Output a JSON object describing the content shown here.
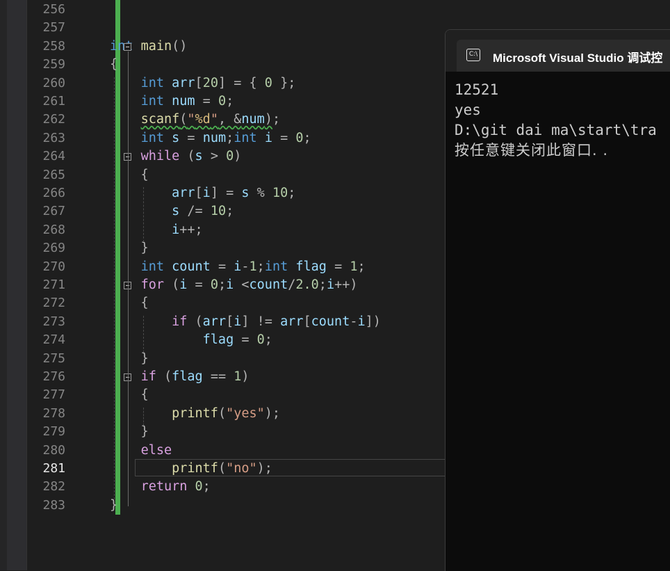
{
  "editor": {
    "lines": [
      {
        "n": "256"
      },
      {
        "n": "257"
      },
      {
        "n": "258"
      },
      {
        "n": "259"
      },
      {
        "n": "260"
      },
      {
        "n": "261"
      },
      {
        "n": "262"
      },
      {
        "n": "263"
      },
      {
        "n": "264"
      },
      {
        "n": "265"
      },
      {
        "n": "266"
      },
      {
        "n": "267"
      },
      {
        "n": "268"
      },
      {
        "n": "269"
      },
      {
        "n": "270"
      },
      {
        "n": "271"
      },
      {
        "n": "272"
      },
      {
        "n": "273"
      },
      {
        "n": "274"
      },
      {
        "n": "275"
      },
      {
        "n": "276"
      },
      {
        "n": "277"
      },
      {
        "n": "278"
      },
      {
        "n": "279"
      },
      {
        "n": "280"
      },
      {
        "n": "281"
      },
      {
        "n": "282"
      },
      {
        "n": "283"
      }
    ],
    "active_line": "281",
    "code": {
      "l258": [
        [
          "kw",
          "int"
        ],
        [
          "pun",
          " "
        ],
        [
          "fn",
          "main"
        ],
        [
          "pun",
          "()"
        ]
      ],
      "l259": [
        [
          "pun",
          "{"
        ]
      ],
      "l260": [
        [
          "pun",
          "    "
        ],
        [
          "kw",
          "int"
        ],
        [
          "pun",
          " "
        ],
        [
          "var",
          "arr"
        ],
        [
          "pun",
          "["
        ],
        [
          "num",
          "20"
        ],
        [
          "pun",
          "] = { "
        ],
        [
          "num",
          "0"
        ],
        [
          "pun",
          " };"
        ]
      ],
      "l261": [
        [
          "pun",
          "    "
        ],
        [
          "kw",
          "int"
        ],
        [
          "pun",
          " "
        ],
        [
          "var",
          "num"
        ],
        [
          "pun",
          " = "
        ],
        [
          "num",
          "0"
        ],
        [
          "pun",
          ";"
        ]
      ],
      "l262": [
        [
          "pun",
          "    "
        ],
        [
          "fn squig",
          "scanf"
        ],
        [
          "pun squig",
          "("
        ],
        [
          "str squig",
          "\""
        ],
        [
          "fmt squig",
          "%d"
        ],
        [
          "str squig",
          "\""
        ],
        [
          "pun squig",
          ", &"
        ],
        [
          "var squig",
          "num"
        ],
        [
          "pun squig",
          ")"
        ],
        [
          "pun",
          ";"
        ]
      ],
      "l263": [
        [
          "pun",
          "    "
        ],
        [
          "kw",
          "int"
        ],
        [
          "pun",
          " "
        ],
        [
          "var",
          "s"
        ],
        [
          "pun",
          " = "
        ],
        [
          "var",
          "num"
        ],
        [
          "pun",
          ";"
        ],
        [
          "kw",
          "int"
        ],
        [
          "pun",
          " "
        ],
        [
          "var",
          "i"
        ],
        [
          "pun",
          " = "
        ],
        [
          "num",
          "0"
        ],
        [
          "pun",
          ";"
        ]
      ],
      "l264": [
        [
          "pun",
          "    "
        ],
        [
          "ctl",
          "while"
        ],
        [
          "pun",
          " ("
        ],
        [
          "var",
          "s"
        ],
        [
          "pun",
          " > "
        ],
        [
          "num",
          "0"
        ],
        [
          "pun",
          ")"
        ]
      ],
      "l265": [
        [
          "pun",
          "    {"
        ]
      ],
      "l266": [
        [
          "pun",
          "        "
        ],
        [
          "var",
          "arr"
        ],
        [
          "pun",
          "["
        ],
        [
          "var",
          "i"
        ],
        [
          "pun",
          "] = "
        ],
        [
          "var",
          "s"
        ],
        [
          "pun",
          " % "
        ],
        [
          "num",
          "10"
        ],
        [
          "pun",
          ";"
        ]
      ],
      "l267": [
        [
          "pun",
          "        "
        ],
        [
          "var",
          "s"
        ],
        [
          "pun",
          " /= "
        ],
        [
          "num",
          "10"
        ],
        [
          "pun",
          ";"
        ]
      ],
      "l268": [
        [
          "pun",
          "        "
        ],
        [
          "var",
          "i"
        ],
        [
          "pun",
          "++;"
        ]
      ],
      "l269": [
        [
          "pun",
          "    }"
        ]
      ],
      "l270": [
        [
          "pun",
          "    "
        ],
        [
          "kw",
          "int"
        ],
        [
          "pun",
          " "
        ],
        [
          "var",
          "count"
        ],
        [
          "pun",
          " = "
        ],
        [
          "var",
          "i"
        ],
        [
          "pun",
          "-"
        ],
        [
          "num",
          "1"
        ],
        [
          "pun",
          ";"
        ],
        [
          "kw",
          "int"
        ],
        [
          "pun",
          " "
        ],
        [
          "var",
          "flag"
        ],
        [
          "pun",
          " = "
        ],
        [
          "num",
          "1"
        ],
        [
          "pun",
          ";"
        ]
      ],
      "l271": [
        [
          "pun",
          "    "
        ],
        [
          "ctl",
          "for"
        ],
        [
          "pun",
          " ("
        ],
        [
          "var",
          "i"
        ],
        [
          "pun",
          " = "
        ],
        [
          "num",
          "0"
        ],
        [
          "pun",
          ";"
        ],
        [
          "var",
          "i"
        ],
        [
          "pun",
          " <"
        ],
        [
          "var",
          "count"
        ],
        [
          "pun",
          "/"
        ],
        [
          "num",
          "2.0"
        ],
        [
          "pun",
          ";"
        ],
        [
          "var",
          "i"
        ],
        [
          "pun",
          "++)"
        ]
      ],
      "l272": [
        [
          "pun",
          "    {"
        ]
      ],
      "l273": [
        [
          "pun",
          "        "
        ],
        [
          "ctl",
          "if"
        ],
        [
          "pun",
          " ("
        ],
        [
          "var",
          "arr"
        ],
        [
          "pun",
          "["
        ],
        [
          "var",
          "i"
        ],
        [
          "pun",
          "] != "
        ],
        [
          "var",
          "arr"
        ],
        [
          "pun",
          "["
        ],
        [
          "var",
          "count"
        ],
        [
          "pun",
          "-"
        ],
        [
          "var",
          "i"
        ],
        [
          "pun",
          "])"
        ]
      ],
      "l274": [
        [
          "pun",
          "            "
        ],
        [
          "var",
          "flag"
        ],
        [
          "pun",
          " = "
        ],
        [
          "num",
          "0"
        ],
        [
          "pun",
          ";"
        ]
      ],
      "l275": [
        [
          "pun",
          "    }"
        ]
      ],
      "l276": [
        [
          "pun",
          "    "
        ],
        [
          "ctl",
          "if"
        ],
        [
          "pun",
          " ("
        ],
        [
          "var",
          "flag"
        ],
        [
          "pun",
          " == "
        ],
        [
          "num",
          "1"
        ],
        [
          "pun",
          ")"
        ]
      ],
      "l277": [
        [
          "pun",
          "    {"
        ]
      ],
      "l278": [
        [
          "pun",
          "        "
        ],
        [
          "fn",
          "printf"
        ],
        [
          "pun",
          "("
        ],
        [
          "str",
          "\"yes\""
        ],
        [
          "pun",
          ");"
        ]
      ],
      "l279": [
        [
          "pun",
          "    }"
        ]
      ],
      "l280": [
        [
          "pun",
          "    "
        ],
        [
          "ctl",
          "else"
        ]
      ],
      "l281": [
        [
          "pun",
          "        "
        ],
        [
          "fn",
          "printf"
        ],
        [
          "pun",
          "("
        ],
        [
          "str",
          "\"no\""
        ],
        [
          "pun",
          ");"
        ]
      ],
      "l282": [
        [
          "pun",
          "    "
        ],
        [
          "ctl",
          "return"
        ],
        [
          "pun",
          " "
        ],
        [
          "num",
          "0"
        ],
        [
          "pun",
          ";"
        ]
      ],
      "l283": [
        [
          "pun",
          "}"
        ]
      ]
    }
  },
  "console": {
    "title": "Microsoft Visual Studio 调试控",
    "icon": "console-app-icon",
    "icon_text": "C:\\",
    "output": [
      "12521",
      "yes",
      "D:\\git dai ma\\start\\tra",
      "按任意键关闭此窗口. ."
    ]
  },
  "colors": {
    "change_bar": "#4caf50",
    "background": "#1e1e1e",
    "console_bg": "#0c0c0c"
  }
}
